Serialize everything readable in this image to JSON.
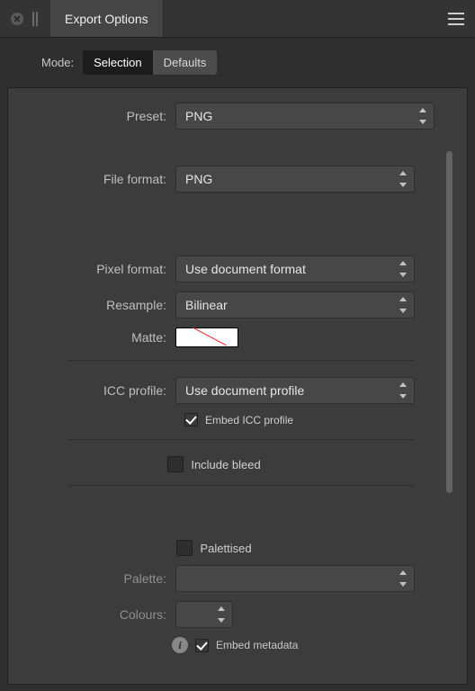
{
  "titlebar": {
    "tab_label": "Export Options"
  },
  "mode": {
    "label": "Mode:",
    "selection": "Selection",
    "defaults": "Defaults"
  },
  "preset": {
    "label": "Preset:",
    "value": "PNG"
  },
  "file_format": {
    "label": "File format:",
    "value": "PNG"
  },
  "pixel_format": {
    "label": "Pixel format:",
    "value": "Use document format"
  },
  "resample": {
    "label": "Resample:",
    "value": "Bilinear"
  },
  "matte": {
    "label": "Matte:"
  },
  "icc": {
    "label": "ICC profile:",
    "value": "Use document profile",
    "embed_label": "Embed ICC profile"
  },
  "include_bleed": {
    "label": "Include bleed"
  },
  "palettised": {
    "label": "Palettised"
  },
  "palette": {
    "label": "Palette:"
  },
  "colours": {
    "label": "Colours:"
  },
  "embed_metadata": {
    "label": "Embed metadata"
  }
}
